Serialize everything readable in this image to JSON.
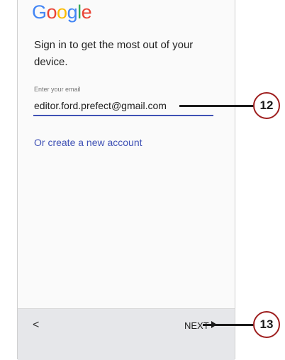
{
  "logo": {
    "letters": [
      "G",
      "o",
      "o",
      "g",
      "l",
      "e"
    ]
  },
  "headline": "Sign in to get the most out of your device.",
  "email": {
    "label": "Enter your email",
    "value": "editor.ford.prefect@gmail.com"
  },
  "create_account_link": "Or create a new account",
  "bottom_bar": {
    "back_label": "<",
    "next_label": "NEXT"
  },
  "callouts": [
    {
      "number": "12"
    },
    {
      "number": "13"
    }
  ],
  "colors": {
    "accent": "#3f51b5",
    "callout_border": "#9e1e1e",
    "bottom_bar": "#e6e7ea"
  }
}
